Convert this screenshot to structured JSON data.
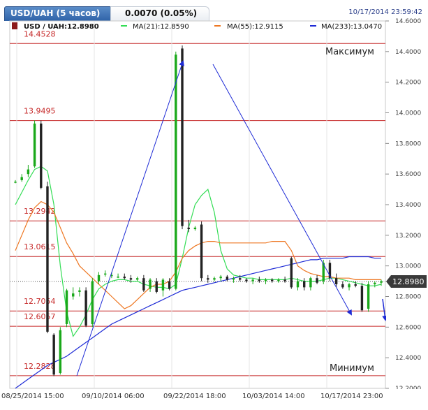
{
  "header": {
    "tab_label": "USD/UAH (5 часов)",
    "change": "0.0070 (0.05%)",
    "datetime": "10/17/2014 23:59:42"
  },
  "legend": {
    "symbol": "USD / UAH:12.8980",
    "ma21": "MA(21):12.8590",
    "ma55": "MA(55):12.9115",
    "ma233": "MA(233):13.0470"
  },
  "colors": {
    "up": "#1aa81a",
    "down": "#222222",
    "ma21": "#33dd55",
    "ma55": "#ee7722",
    "ma233": "#1e2bd6",
    "level": "#c62828",
    "level_text": "#c62828",
    "arrow": "#1e2bd6",
    "price_tag": "#3a3a3a"
  },
  "annotations": {
    "max_label": "Максимум",
    "min_label": "Минимум"
  },
  "chart_data": {
    "type": "candlestick",
    "symbol": "USD/UAH",
    "ylim": [
      12.2,
      14.6
    ],
    "y_ticks": [
      "14.6000",
      "14.4000",
      "14.2000",
      "14.0000",
      "13.8000",
      "13.6000",
      "13.4000",
      "13.2000",
      "13.0000",
      "12.8000",
      "12.6000",
      "12.4000",
      "12.2000"
    ],
    "x_ticks": [
      "08/25/2014 15:00",
      "09/10/2014 06:00",
      "09/22/2014 18:00",
      "10/03/2014 14:00",
      "10/17/2014 23:00"
    ],
    "current_price": 12.898,
    "current_price_label": "12.8980",
    "levels": [
      {
        "value": 14.4528,
        "label": "14.4528"
      },
      {
        "value": 13.9495,
        "label": "13.9495"
      },
      {
        "value": 13.2942,
        "label": "13.2942"
      },
      {
        "value": 13.0615,
        "label": "13.0615"
      },
      {
        "value": 12.7054,
        "label": "12.7054"
      },
      {
        "value": 12.6057,
        "label": "12.6057"
      },
      {
        "value": 12.2828,
        "label": "12.2828"
      }
    ],
    "candles": [
      {
        "o": 13.55,
        "h": 13.56,
        "l": 13.54,
        "c": 13.55
      },
      {
        "o": 13.56,
        "h": 13.6,
        "l": 13.55,
        "c": 13.58
      },
      {
        "o": 13.6,
        "h": 13.66,
        "l": 13.58,
        "c": 13.63
      },
      {
        "o": 13.65,
        "h": 13.95,
        "l": 13.64,
        "c": 13.93
      },
      {
        "o": 13.93,
        "h": 13.95,
        "l": 13.5,
        "c": 13.51
      },
      {
        "o": 13.52,
        "h": 13.55,
        "l": 12.56,
        "c": 12.57
      },
      {
        "o": 12.55,
        "h": 12.56,
        "l": 12.28,
        "c": 12.29
      },
      {
        "o": 12.3,
        "h": 12.6,
        "l": 12.29,
        "c": 12.58
      },
      {
        "o": 12.62,
        "h": 12.85,
        "l": 12.6,
        "c": 12.84
      },
      {
        "o": 12.8,
        "h": 12.86,
        "l": 12.78,
        "c": 12.82
      },
      {
        "o": 12.83,
        "h": 12.86,
        "l": 12.8,
        "c": 12.84
      },
      {
        "o": 12.84,
        "h": 12.86,
        "l": 12.6,
        "c": 12.61
      },
      {
        "o": 12.62,
        "h": 12.92,
        "l": 12.6,
        "c": 12.9
      },
      {
        "o": 12.9,
        "h": 12.96,
        "l": 12.88,
        "c": 12.94
      },
      {
        "o": 12.95,
        "h": 12.97,
        "l": 12.93,
        "c": 12.95
      },
      {
        "o": 12.94,
        "h": 12.96,
        "l": 12.92,
        "c": 12.94
      },
      {
        "o": 12.93,
        "h": 12.95,
        "l": 12.92,
        "c": 12.93
      },
      {
        "o": 12.93,
        "h": 12.95,
        "l": 12.91,
        "c": 12.92
      },
      {
        "o": 12.92,
        "h": 12.94,
        "l": 12.89,
        "c": 12.91
      },
      {
        "o": 12.91,
        "h": 12.93,
        "l": 12.9,
        "c": 12.92
      },
      {
        "o": 12.92,
        "h": 12.94,
        "l": 12.83,
        "c": 12.84
      },
      {
        "o": 12.85,
        "h": 12.92,
        "l": 12.83,
        "c": 12.91
      },
      {
        "o": 12.9,
        "h": 12.92,
        "l": 12.82,
        "c": 12.83
      },
      {
        "o": 12.84,
        "h": 12.92,
        "l": 12.8,
        "c": 12.91
      },
      {
        "o": 12.9,
        "h": 12.92,
        "l": 12.84,
        "c": 12.85
      },
      {
        "o": 12.85,
        "h": 14.4,
        "l": 12.84,
        "c": 14.38
      },
      {
        "o": 14.42,
        "h": 14.44,
        "l": 13.24,
        "c": 13.26
      },
      {
        "o": 13.25,
        "h": 13.3,
        "l": 13.22,
        "c": 13.24
      },
      {
        "o": 13.24,
        "h": 13.26,
        "l": 13.23,
        "c": 13.25
      },
      {
        "o": 13.27,
        "h": 13.29,
        "l": 12.9,
        "c": 12.92
      },
      {
        "o": 12.92,
        "h": 12.94,
        "l": 12.89,
        "c": 12.91
      },
      {
        "o": 12.91,
        "h": 12.93,
        "l": 12.9,
        "c": 12.92
      },
      {
        "o": 12.92,
        "h": 12.94,
        "l": 12.9,
        "c": 12.93
      },
      {
        "o": 12.93,
        "h": 12.94,
        "l": 12.9,
        "c": 12.91
      },
      {
        "o": 12.91,
        "h": 12.93,
        "l": 12.89,
        "c": 12.92
      },
      {
        "o": 12.92,
        "h": 12.94,
        "l": 12.9,
        "c": 12.91
      },
      {
        "o": 12.91,
        "h": 12.92,
        "l": 12.89,
        "c": 12.9
      },
      {
        "o": 12.9,
        "h": 12.92,
        "l": 12.88,
        "c": 12.91
      },
      {
        "o": 12.91,
        "h": 12.93,
        "l": 12.89,
        "c": 12.9
      },
      {
        "o": 12.9,
        "h": 12.92,
        "l": 12.88,
        "c": 12.91
      },
      {
        "o": 12.91,
        "h": 12.92,
        "l": 12.89,
        "c": 12.9
      },
      {
        "o": 12.9,
        "h": 12.92,
        "l": 12.89,
        "c": 12.91
      },
      {
        "o": 12.91,
        "h": 12.93,
        "l": 12.89,
        "c": 12.9
      },
      {
        "o": 13.05,
        "h": 13.06,
        "l": 12.85,
        "c": 12.86
      },
      {
        "o": 12.86,
        "h": 12.92,
        "l": 12.84,
        "c": 12.9
      },
      {
        "o": 12.9,
        "h": 12.92,
        "l": 12.84,
        "c": 12.86
      },
      {
        "o": 12.86,
        "h": 12.93,
        "l": 12.84,
        "c": 12.92
      },
      {
        "o": 12.92,
        "h": 12.94,
        "l": 12.88,
        "c": 12.89
      },
      {
        "o": 12.9,
        "h": 13.04,
        "l": 12.88,
        "c": 13.02
      },
      {
        "o": 13.02,
        "h": 13.04,
        "l": 12.9,
        "c": 12.92
      },
      {
        "o": 12.92,
        "h": 12.95,
        "l": 12.86,
        "c": 12.88
      },
      {
        "o": 12.88,
        "h": 12.9,
        "l": 12.85,
        "c": 12.86
      },
      {
        "o": 12.86,
        "h": 12.89,
        "l": 12.84,
        "c": 12.88
      },
      {
        "o": 12.88,
        "h": 12.9,
        "l": 12.86,
        "c": 12.87
      },
      {
        "o": 12.87,
        "h": 12.89,
        "l": 12.7,
        "c": 12.71
      },
      {
        "o": 12.72,
        "h": 12.9,
        "l": 12.7,
        "c": 12.88
      },
      {
        "o": 12.88,
        "h": 12.9,
        "l": 12.86,
        "c": 12.89
      },
      {
        "o": 12.89,
        "h": 12.91,
        "l": 12.87,
        "c": 12.9
      }
    ],
    "series": [
      {
        "name": "MA(21)",
        "values": [
          13.4,
          13.48,
          13.56,
          13.63,
          13.65,
          13.62,
          13.4,
          13.0,
          12.7,
          12.54,
          12.6,
          12.68,
          12.78,
          12.85,
          12.88,
          12.9,
          12.91,
          12.91,
          12.9,
          12.9,
          12.88,
          12.87,
          12.86,
          12.86,
          12.85,
          12.88,
          13.05,
          13.25,
          13.4,
          13.46,
          13.5,
          13.35,
          13.1,
          12.98,
          12.94,
          12.93,
          12.92,
          12.92,
          12.91,
          12.91,
          12.91,
          12.91,
          12.91,
          12.92,
          12.91,
          12.9,
          12.9,
          12.9,
          12.91,
          12.92,
          12.92,
          12.91,
          12.9,
          12.89,
          12.88,
          12.87,
          12.87,
          12.88
        ]
      },
      {
        "name": "MA(55)",
        "values": [
          13.1,
          13.2,
          13.3,
          13.38,
          13.42,
          13.4,
          13.35,
          13.25,
          13.15,
          13.08,
          13.0,
          12.96,
          12.92,
          12.88,
          12.84,
          12.8,
          12.76,
          12.72,
          12.74,
          12.78,
          12.82,
          12.86,
          12.88,
          12.88,
          12.9,
          12.96,
          13.05,
          13.1,
          13.13,
          13.15,
          13.16,
          13.16,
          13.15,
          13.15,
          13.15,
          13.15,
          13.15,
          13.15,
          13.15,
          13.15,
          13.16,
          13.16,
          13.16,
          13.1,
          13.0,
          12.97,
          12.95,
          12.94,
          12.93,
          12.93,
          12.92,
          12.92,
          12.92,
          12.91,
          12.91,
          12.91,
          12.91,
          12.91
        ]
      },
      {
        "name": "MA(233)",
        "values": [
          12.2,
          12.23,
          12.26,
          12.29,
          12.32,
          12.35,
          12.37,
          12.39,
          12.41,
          12.44,
          12.47,
          12.5,
          12.53,
          12.56,
          12.59,
          12.62,
          12.64,
          12.66,
          12.68,
          12.7,
          12.72,
          12.74,
          12.76,
          12.78,
          12.8,
          12.82,
          12.84,
          12.85,
          12.86,
          12.87,
          12.88,
          12.89,
          12.9,
          12.91,
          12.92,
          12.93,
          12.94,
          12.95,
          12.96,
          12.97,
          12.98,
          12.99,
          13.0,
          13.01,
          13.02,
          13.03,
          13.04,
          13.04,
          13.05,
          13.05,
          13.05,
          13.05,
          13.06,
          13.06,
          13.06,
          13.06,
          13.05,
          13.05
        ]
      }
    ]
  }
}
